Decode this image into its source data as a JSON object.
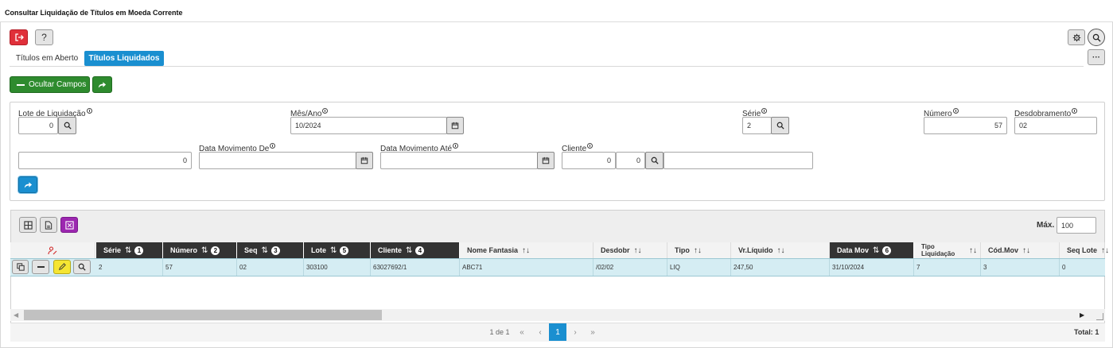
{
  "window": {
    "title": "Consultar Liquidação de Títulos em Moeda Corrente"
  },
  "toolbar": {
    "exit_icon": "exit-icon",
    "help_label": "?",
    "settings_icon": "gear-icon",
    "search_icon": "search-icon",
    "more_label": "···"
  },
  "tabs": [
    {
      "label": "Títulos em Aberto",
      "active": false
    },
    {
      "label": "Títulos Liquidados",
      "active": true
    }
  ],
  "actions": {
    "hide_fields_label": "Ocultar Campos",
    "hide_fields_icon": "minus-icon",
    "forward_icon": "share-arrow-icon"
  },
  "filters": {
    "lote": {
      "label": "Lote de Liquidação",
      "value": "0"
    },
    "mes_ano": {
      "label": "Mês/Ano",
      "value": "10/2024"
    },
    "serie": {
      "label": "Série",
      "value": "2"
    },
    "numero": {
      "label": "Número",
      "value": "57"
    },
    "desdobramento": {
      "label": "Desdobramento",
      "value": "02"
    },
    "blank_field": {
      "value": "0"
    },
    "data_mov_de": {
      "label": "Data Movimento De",
      "value": ""
    },
    "data_mov_ate": {
      "label": "Data Movimento Até",
      "value": ""
    },
    "cliente": {
      "label": "Cliente",
      "value1": "0",
      "value2": "0",
      "name": ""
    }
  },
  "grid": {
    "max_label": "Máx.",
    "max_value": "100",
    "columns": [
      {
        "label": "Série",
        "order": "1",
        "sorted": true
      },
      {
        "label": "Número",
        "order": "2",
        "sorted": true
      },
      {
        "label": "Seq",
        "order": "3",
        "sorted": true
      },
      {
        "label": "Lote",
        "order": "5",
        "sorted": true
      },
      {
        "label": "Cliente",
        "order": "4",
        "sorted": true
      },
      {
        "label": "Nome Fantasia",
        "sorted": false
      },
      {
        "label": "Desdobr",
        "sorted": false
      },
      {
        "label": "Tipo",
        "sorted": false
      },
      {
        "label": "Vr.Líquido",
        "sorted": false
      },
      {
        "label": "Data Mov",
        "order": "6",
        "sorted": true
      },
      {
        "label": "Tipo Liquidação",
        "sorted": false
      },
      {
        "label": "Cód.Mov",
        "sorted": false
      },
      {
        "label": "Seq Lote",
        "sorted": false
      }
    ],
    "rows": [
      [
        "2",
        "57",
        "02",
        "303100",
        "63027692/1",
        "ABC71",
        "/02/02",
        "LIQ",
        "247,50",
        "31/10/2024",
        "7",
        "3",
        "0"
      ]
    ],
    "pagination": {
      "page_info": "1 de 1",
      "first": "«",
      "prev": "‹",
      "current": "1",
      "next": "›",
      "last": "»"
    },
    "total_label": "Total: 1"
  },
  "colors": {
    "accent_blue": "#1a8fd0",
    "green": "#2e8b2e",
    "red": "#e0303a",
    "purple": "#9c27b0",
    "yellow": "#f5e533",
    "header_dark": "#333333",
    "row_selected": "#d5edf3"
  }
}
